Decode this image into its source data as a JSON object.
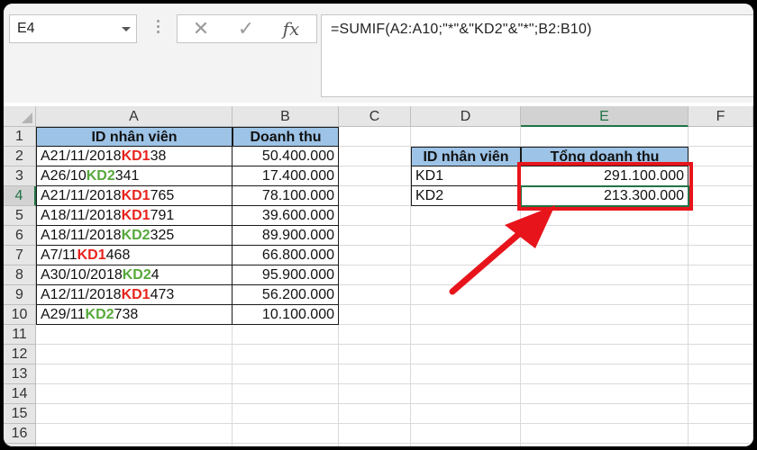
{
  "name_box": {
    "value": "E4"
  },
  "toolbar": {
    "cancel_glyph": "✕",
    "enter_glyph": "✓",
    "fx_glyph": "fx"
  },
  "formula_bar": {
    "value": "=SUMIF(A2:A10;\"*\"&\"KD2\"&\"*\";B2:B10)"
  },
  "columns": [
    "A",
    "B",
    "C",
    "D",
    "E",
    "F"
  ],
  "active_cell": "E4",
  "rows": [
    "1",
    "2",
    "3",
    "4",
    "5",
    "6",
    "7",
    "8",
    "9",
    "10",
    "11",
    "12",
    "13",
    "14",
    "15",
    "16",
    "17"
  ],
  "table1": {
    "headers": [
      "ID nhân viên",
      "Doanh thu"
    ],
    "rows": [
      {
        "pre": "A21/11/2018",
        "code": "KD1",
        "post": "38",
        "value": "50.400.000"
      },
      {
        "pre": "A26/10",
        "code": "KD2",
        "post": "341",
        "value": "17.400.000"
      },
      {
        "pre": "A21/11/2018",
        "code": "KD1",
        "post": "765",
        "value": "78.100.000"
      },
      {
        "pre": "A18/11/2018",
        "code": "KD1",
        "post": "791",
        "value": "39.600.000"
      },
      {
        "pre": "A18/11/2018",
        "code": "KD2",
        "post": "325",
        "value": "89.900.000"
      },
      {
        "pre": "A7/11",
        "code": "KD1",
        "post": "468",
        "value": "66.800.000"
      },
      {
        "pre": "A30/10/2018",
        "code": "KD2",
        "post": "4",
        "value": "95.900.000"
      },
      {
        "pre": "A12/11/2018",
        "code": "KD1",
        "post": "473",
        "value": "56.200.000"
      },
      {
        "pre": "A29/11",
        "code": "KD2",
        "post": "738",
        "value": "10.100.000"
      }
    ]
  },
  "table2": {
    "headers": [
      "ID nhân viên",
      "Tổng doanh thu"
    ],
    "rows": [
      {
        "id": "KD1",
        "total": "291.100.000"
      },
      {
        "id": "KD2",
        "total": "213.300.000"
      }
    ]
  },
  "colors": {
    "excel_green": "#217346",
    "header_fill": "#9dc3e6",
    "kd1": "#e8231d",
    "kd2": "#56a93b",
    "annotation_red": "#e8141b"
  },
  "icons": [
    "cancel-icon",
    "enter-icon",
    "fx-icon",
    "dropdown-arrow-icon",
    "arrow-annotation"
  ]
}
